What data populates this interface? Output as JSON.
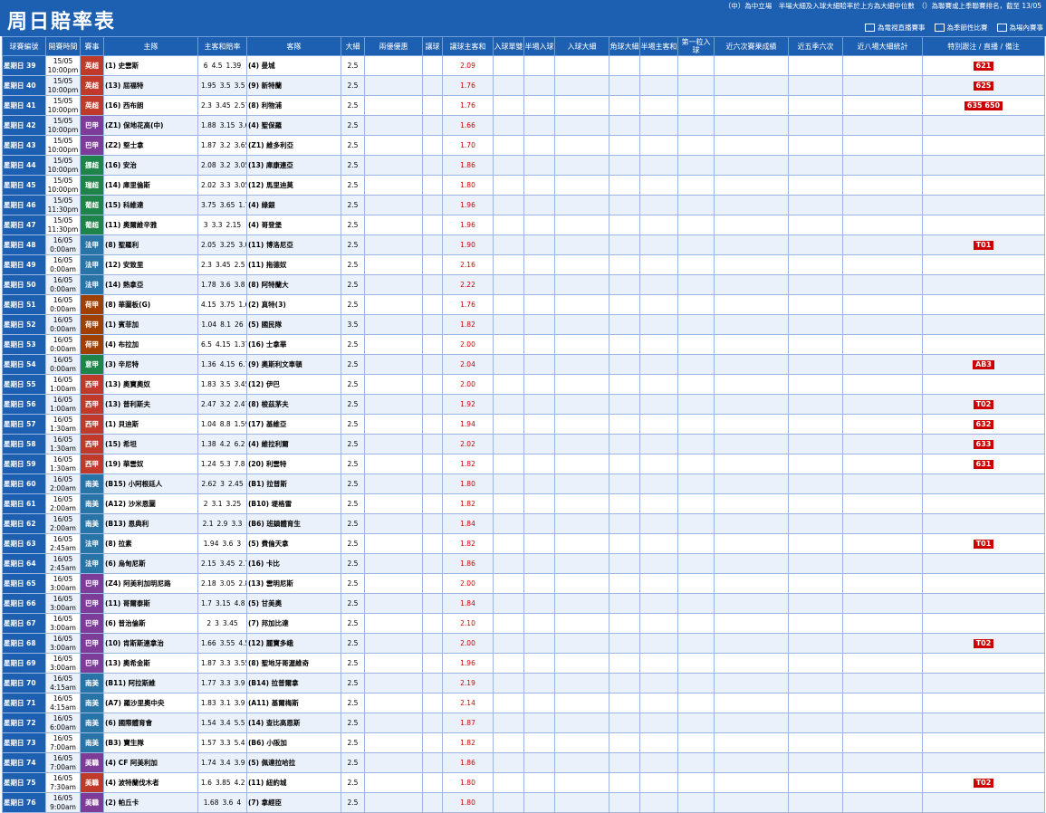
{
  "header": {
    "title": "周日賠率表",
    "notes": "（中）為中立場　半場大細及入球大細賠率於上方為大細中位數　（）為聯賽或上季聯賽排名，截至 13/05",
    "legend": [
      {
        "label": "為電視直播賽事",
        "color": "#ffffff"
      },
      {
        "label": "為季節性比賽",
        "color": "#ffffff"
      },
      {
        "label": "為場內賽事",
        "color": "#ffffff"
      }
    ]
  },
  "columns": [
    "球賽編號",
    "開賽時間",
    "賽事",
    "主隊",
    "主客和賠率",
    "客隊",
    "大細",
    "兩優優惠",
    "讓球",
    "讓球主客和",
    "入球單雙",
    "半場入球",
    "入球大細",
    "角球大細",
    "半場主客和",
    "第一粒入球",
    "近六次賽果成績",
    "近五季六次",
    "近八場大細統計",
    "特別跟注 / 直播 / 備注"
  ],
  "rows": [
    {
      "code": "星期日 39",
      "date": "15/05",
      "time": "10:00pm",
      "league": "英超",
      "lc": "#c0392b",
      "home": "(1) 史雲斯",
      "away": "(4) 曼城",
      "o1": "6",
      "o2": "4.5",
      "o3": "1.39",
      "hc": "2.09",
      "ou": "2.5",
      "tv": "621"
    },
    {
      "code": "星期日 40",
      "date": "15/05",
      "time": "10:00pm",
      "league": "英超",
      "lc": "#c0392b",
      "home": "(13) 屈福特",
      "away": "(9) 新特蘭",
      "o1": "1.95",
      "o2": "3.5",
      "o3": "3.5",
      "hc": "1.76",
      "ou": "2.5",
      "tv": "625"
    },
    {
      "code": "星期日 41",
      "date": "15/05",
      "time": "10:00pm",
      "league": "英超",
      "lc": "#c0392b",
      "home": "(16) 西布朗",
      "away": "(8) 利物浦",
      "o1": "2.3",
      "o2": "3.45",
      "o3": "2.57",
      "hc": "1.76",
      "ou": "2.5",
      "tv": "635 650"
    },
    {
      "code": "星期日 42",
      "date": "15/05",
      "time": "10:00pm",
      "league": "巴甲",
      "lc": "#7d3c98",
      "home": "(Z1) 保地花高(中)",
      "away": "(4) 聖保羅",
      "o1": "1.88",
      "o2": "3.15",
      "o3": "3.65",
      "hc": "1.66",
      "ou": "2.5",
      "tv": ""
    },
    {
      "code": "星期日 43",
      "date": "15/05",
      "time": "10:00pm",
      "league": "巴甲",
      "lc": "#7d3c98",
      "home": "(Z2) 堅士拿",
      "away": "(Z1) 維多利亞",
      "o1": "1.87",
      "o2": "3.2",
      "o3": "3.65",
      "hc": "1.70",
      "ou": "2.5",
      "tv": ""
    },
    {
      "code": "星期日 44",
      "date": "15/05",
      "time": "10:00pm",
      "league": "挪超",
      "lc": "#1e8449",
      "home": "(16) 安治",
      "away": "(13) 庫康連亞",
      "o1": "2.08",
      "o2": "3.2",
      "o3": "3.05",
      "hc": "1.86",
      "ou": "2.5",
      "tv": ""
    },
    {
      "code": "星期日 45",
      "date": "15/05",
      "time": "10:00pm",
      "league": "瑞超",
      "lc": "#1e8449",
      "home": "(14) 庫里倫斯",
      "away": "(12) 馬里迪莫",
      "o1": "2.02",
      "o2": "3.3",
      "o3": "3.05",
      "hc": "1.80",
      "ou": "2.5",
      "tv": ""
    },
    {
      "code": "星期日 46",
      "date": "15/05",
      "time": "11:30pm",
      "league": "葡超",
      "lc": "#1e8449",
      "home": "(15) 科維達",
      "away": "(4) 綠銀",
      "o1": "3.75",
      "o2": "3.65",
      "o3": "1.72",
      "hc": "1.96",
      "ou": "2.5",
      "tv": ""
    },
    {
      "code": "星期日 47",
      "date": "15/05",
      "time": "11:30pm",
      "league": "葡超",
      "lc": "#1e8449",
      "home": "(11) 奧爾維辛雅",
      "away": "(4) 哥登堡",
      "o1": "3",
      "o2": "3.3",
      "o3": "2.15",
      "hc": "1.96",
      "ou": "2.5",
      "tv": ""
    },
    {
      "code": "星期日 48",
      "date": "16/05",
      "time": "0:00am",
      "league": "法甲",
      "lc": "#2874a6",
      "home": "(8) 聖羅利",
      "away": "(11) 博洛尼亞",
      "o1": "2.05",
      "o2": "3.25",
      "o3": "3.05",
      "hc": "1.90",
      "ou": "2.5",
      "tv": "T01"
    },
    {
      "code": "星期日 49",
      "date": "16/05",
      "time": "0:00am",
      "league": "法甲",
      "lc": "#2874a6",
      "home": "(12) 安致里",
      "away": "(11) 拖德奴",
      "o1": "2.3",
      "o2": "3.45",
      "o3": "2.5",
      "hc": "2.16",
      "ou": "2.5",
      "tv": ""
    },
    {
      "code": "星期日 50",
      "date": "16/05",
      "time": "0:00am",
      "league": "法甲",
      "lc": "#2874a6",
      "home": "(14) 熱拿亞",
      "away": "(8) 阿特蘭大",
      "o1": "1.78",
      "o2": "3.6",
      "o3": "3.8",
      "hc": "2.22",
      "ou": "2.5",
      "tv": ""
    },
    {
      "code": "星期日 51",
      "date": "16/05",
      "time": "0:00am",
      "league": "荷甲",
      "lc": "#a04000",
      "home": "(8) 華圖板(G)",
      "away": "(2) 真特(3)",
      "o1": "4.15",
      "o2": "3.75",
      "o3": "1.62",
      "hc": "1.76",
      "ou": "2.5",
      "tv": ""
    },
    {
      "code": "星期日 52",
      "date": "16/05",
      "time": "0:00am",
      "league": "荷甲",
      "lc": "#a04000",
      "home": "(1) 賓菲加",
      "away": "(5) 國民隊",
      "o1": "1.04",
      "o2": "8.1",
      "o3": "26",
      "hc": "1.82",
      "ou": "3.5",
      "tv": ""
    },
    {
      "code": "星期日 53",
      "date": "16/05",
      "time": "0:00am",
      "league": "荷甲",
      "lc": "#a04000",
      "home": "(4) 布拉加",
      "away": "(16) 士拿華",
      "o1": "6.5",
      "o2": "4.15",
      "o3": "1.37",
      "hc": "2.00",
      "ou": "2.5",
      "tv": ""
    },
    {
      "code": "星期日 54",
      "date": "16/05",
      "time": "0:00am",
      "league": "意甲",
      "lc": "#1e8449",
      "home": "(3) 辛尼特",
      "away": "(9) 奧斯利文車頓",
      "o1": "1.36",
      "o2": "4.15",
      "o3": "6.75",
      "hc": "2.04",
      "ou": "2.5",
      "tv": "AB3"
    },
    {
      "code": "星期日 55",
      "date": "16/05",
      "time": "1:00am",
      "league": "西甲",
      "lc": "#c0392b",
      "home": "(13) 奧寶奧奴",
      "away": "(12) 伊巴",
      "o1": "1.83",
      "o2": "3.5",
      "o3": "3.45",
      "hc": "2.00",
      "ou": "2.5",
      "tv": ""
    },
    {
      "code": "星期日 56",
      "date": "16/05",
      "time": "1:00am",
      "league": "西甲",
      "lc": "#c0392b",
      "home": "(13) 普利斯夫",
      "away": "(8) 梭茲茅夫",
      "o1": "2.47",
      "o2": "3.2",
      "o3": "2.47",
      "hc": "1.92",
      "ou": "2.5",
      "tv": "T02"
    },
    {
      "code": "星期日 57",
      "date": "16/05",
      "time": "1:30am",
      "league": "西甲",
      "lc": "#c0392b",
      "home": "(1) 貝迪斯",
      "away": "(17) 基維亞",
      "o1": "1.04",
      "o2": "8.8",
      "o3": "1.59",
      "hc": "1.94",
      "ou": "2.5",
      "tv": "632"
    },
    {
      "code": "星期日 58",
      "date": "16/05",
      "time": "1:30am",
      "league": "西甲",
      "lc": "#c0392b",
      "home": "(15) 希坦",
      "away": "(4) 維拉利爾",
      "o1": "1.38",
      "o2": "4.2",
      "o3": "6.2",
      "hc": "2.02",
      "ou": "2.5",
      "tv": "633"
    },
    {
      "code": "星期日 59",
      "date": "16/05",
      "time": "1:30am",
      "league": "西甲",
      "lc": "#c0392b",
      "home": "(19) 華雲奴",
      "away": "(20) 利雲特",
      "o1": "1.24",
      "o2": "5.3",
      "o3": "7.8",
      "hc": "1.82",
      "ou": "2.5",
      "tv": "631"
    },
    {
      "code": "星期日 60",
      "date": "16/05",
      "time": "2:00am",
      "league": "南美",
      "lc": "#2874a6",
      "home": "(B15) 小阿根廷人",
      "away": "(B1) 拉普斯",
      "o1": "2.62",
      "o2": "3",
      "o3": "2.45",
      "hc": "1.80",
      "ou": "2.5",
      "tv": ""
    },
    {
      "code": "星期日 61",
      "date": "16/05",
      "time": "2:00am",
      "league": "南美",
      "lc": "#2874a6",
      "home": "(A12) 沙米恩圖",
      "away": "(B10) 堤格雷",
      "o1": "2",
      "o2": "3.1",
      "o3": "3.25",
      "hc": "1.82",
      "ou": "2.5",
      "tv": ""
    },
    {
      "code": "星期日 62",
      "date": "16/05",
      "time": "2:00am",
      "league": "南美",
      "lc": "#2874a6",
      "home": "(B13) 恩典利",
      "away": "(B6) 班鎮體育生",
      "o1": "2.1",
      "o2": "2.9",
      "o3": "3.3",
      "hc": "1.84",
      "ou": "2.5",
      "tv": ""
    },
    {
      "code": "星期日 63",
      "date": "16/05",
      "time": "2:45am",
      "league": "法甲",
      "lc": "#2874a6",
      "home": "(8) 拉素",
      "away": "(5) 費倫天拿",
      "o1": "1.94",
      "o2": "3.6",
      "o3": "3",
      "hc": "1.82",
      "ou": "2.5",
      "tv": "T01"
    },
    {
      "code": "星期日 64",
      "date": "16/05",
      "time": "2:45am",
      "league": "法甲",
      "lc": "#2874a6",
      "home": "(6) 烏甸尼斯",
      "away": "(16) 卡比",
      "o1": "2.15",
      "o2": "3.45",
      "o3": "2.7",
      "hc": "1.86",
      "ou": "2.5",
      "tv": ""
    },
    {
      "code": "星期日 65",
      "date": "16/05",
      "time": "3:00am",
      "league": "巴甲",
      "lc": "#7d3c98",
      "home": "(Z4) 阿美利加明尼路",
      "away": "(13) 雲明尼斯",
      "o1": "2.18",
      "o2": "3.05",
      "o3": "2.85",
      "hc": "2.00",
      "ou": "2.5",
      "tv": ""
    },
    {
      "code": "星期日 66",
      "date": "16/05",
      "time": "3:00am",
      "league": "巴甲",
      "lc": "#7d3c98",
      "home": "(11) 哥爾泰斯",
      "away": "(5) 甘美奧",
      "o1": "1.7",
      "o2": "3.15",
      "o3": "4.8",
      "hc": "1.84",
      "ou": "2.5",
      "tv": ""
    },
    {
      "code": "星期日 67",
      "date": "16/05",
      "time": "3:00am",
      "league": "巴甲",
      "lc": "#7d3c98",
      "home": "(6) 普治倫斯",
      "away": "(7) 邦加比達",
      "o1": "2",
      "o2": "3",
      "o3": "3.45",
      "hc": "2.10",
      "ou": "2.5",
      "tv": ""
    },
    {
      "code": "星期日 68",
      "date": "16/05",
      "time": "3:00am",
      "league": "巴甲",
      "lc": "#7d3c98",
      "home": "(10) 肯斯斯連拿治",
      "away": "(12) 麗寶多峨",
      "o1": "1.66",
      "o2": "3.55",
      "o3": "4.5",
      "hc": "2.00",
      "ou": "2.5",
      "tv": "T02"
    },
    {
      "code": "星期日 69",
      "date": "16/05",
      "time": "3:00am",
      "league": "巴甲",
      "lc": "#7d3c98",
      "home": "(13) 奧希金斯",
      "away": "(8) 聖地牙哥渥維奇",
      "o1": "1.87",
      "o2": "3.3",
      "o3": "3.55",
      "hc": "1.96",
      "ou": "2.5",
      "tv": ""
    },
    {
      "code": "星期日 70",
      "date": "16/05",
      "time": "4:15am",
      "league": "南美",
      "lc": "#2874a6",
      "home": "(B11) 阿拉斯維",
      "away": "(B14) 拉普爾拿",
      "o1": "1.77",
      "o2": "3.3",
      "o3": "3.9",
      "hc": "2.19",
      "ou": "2.5",
      "tv": ""
    },
    {
      "code": "星期日 71",
      "date": "16/05",
      "time": "4:15am",
      "league": "南美",
      "lc": "#2874a6",
      "home": "(A7) 羅沙里奧中央",
      "away": "(A11) 基爾梅斯",
      "o1": "1.83",
      "o2": "3.1",
      "o3": "3.9",
      "hc": "2.14",
      "ou": "2.5",
      "tv": ""
    },
    {
      "code": "星期日 72",
      "date": "16/05",
      "time": "6:00am",
      "league": "南美",
      "lc": "#2874a6",
      "home": "(6) 國際體育會",
      "away": "(14) 查比高恩斯",
      "o1": "1.54",
      "o2": "3.4",
      "o3": "5.5",
      "hc": "1.87",
      "ou": "2.5",
      "tv": ""
    },
    {
      "code": "星期日 73",
      "date": "16/05",
      "time": "7:00am",
      "league": "南美",
      "lc": "#2874a6",
      "home": "(B3) 寶生隊",
      "away": "(B6) 小阪加",
      "o1": "1.57",
      "o2": "3.3",
      "o3": "5.4",
      "hc": "1.82",
      "ou": "2.5",
      "tv": ""
    },
    {
      "code": "星期日 74",
      "date": "16/05",
      "time": "7:00am",
      "league": "美職",
      "lc": "#7d3c98",
      "home": "(4) CF 阿美利加",
      "away": "(5) 佩達拉哈拉",
      "o1": "1.74",
      "o2": "3.4",
      "o3": "3.9",
      "hc": "1.86",
      "ou": "2.5",
      "tv": ""
    },
    {
      "code": "星期日 75",
      "date": "16/05",
      "time": "7:30am",
      "league": "美職",
      "lc": "#c0392b",
      "home": "(4) 波特蘭伐木者",
      "away": "(11) 紐約城",
      "o1": "1.6",
      "o2": "3.85",
      "o3": "4.2",
      "hc": "1.80",
      "ou": "2.5",
      "tv": "T02"
    },
    {
      "code": "星期日 76",
      "date": "16/05",
      "time": "9:00am",
      "league": "美職",
      "lc": "#7d3c98",
      "home": "(2) 帕丘卡",
      "away": "(7) 拿經臣",
      "o1": "1.68",
      "o2": "3.6",
      "o3": "4",
      "hc": "1.80",
      "ou": "2.5",
      "tv": ""
    }
  ]
}
